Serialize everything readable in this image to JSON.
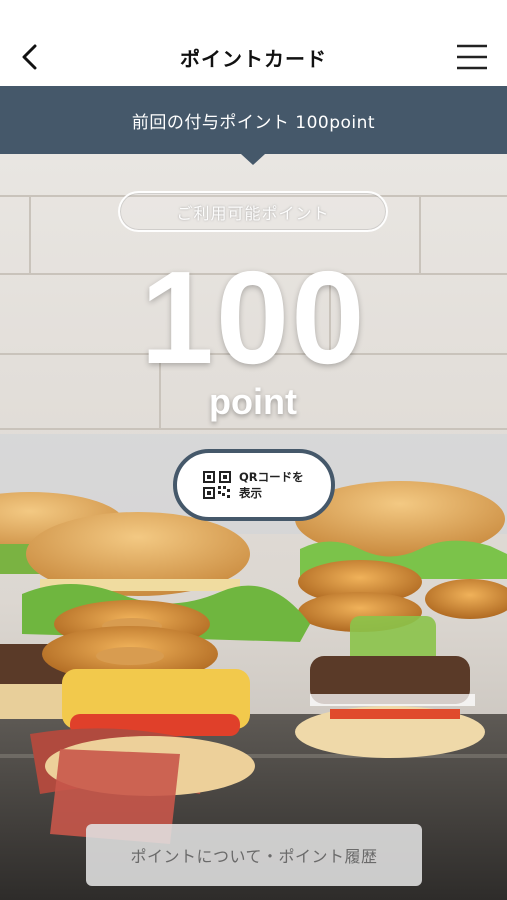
{
  "header": {
    "title": "ポイントカード",
    "back_icon": "chevron-left-icon",
    "menu_icon": "hamburger-menu-icon"
  },
  "banner": {
    "text": "前回の付与ポイント 100point"
  },
  "points": {
    "label": "ご利用可能ポイント",
    "value": "100",
    "unit": "point"
  },
  "qr_button": {
    "line1": "QRコードを",
    "line2": "表示",
    "icon": "qr-code-icon"
  },
  "footer": {
    "history_label": "ポイントについて・ポイント履歴"
  },
  "colors": {
    "banner": "#45586a",
    "background": "#ffffff",
    "accent_text": "#ffffff"
  }
}
